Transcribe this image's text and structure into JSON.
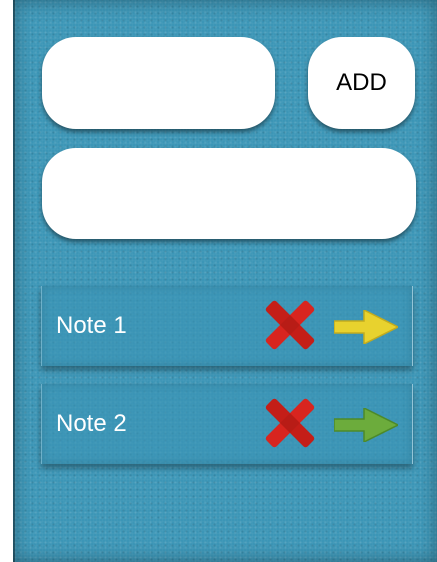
{
  "form": {
    "title_value": "",
    "body_value": "",
    "add_label": "ADD"
  },
  "notes": [
    {
      "label": "Note 1",
      "arrow_color": "#e8d22e",
      "delete_icon": "x-icon",
      "open_icon": "arrow-right-icon"
    },
    {
      "label": "Note 2",
      "arrow_color": "#6cac3c",
      "delete_icon": "x-icon",
      "open_icon": "arrow-right-icon"
    }
  ],
  "colors": {
    "background": "#3a95b6",
    "delete": "#d8251f"
  }
}
